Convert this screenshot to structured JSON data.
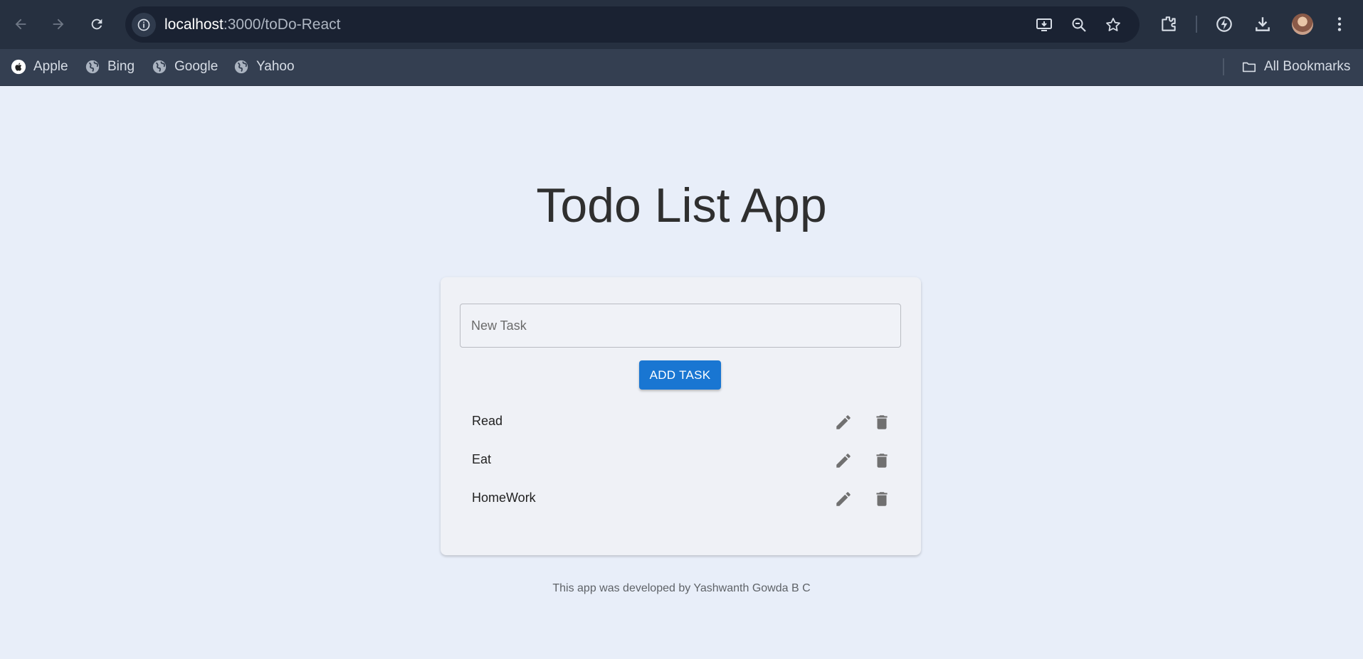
{
  "browser": {
    "url_host": "localhost",
    "url_path": ":3000/toDo-React",
    "bookmarks": [
      {
        "label": "Apple",
        "icon": "apple-icon"
      },
      {
        "label": "Bing",
        "icon": "globe-icon"
      },
      {
        "label": "Google",
        "icon": "globe-icon"
      },
      {
        "label": "Yahoo",
        "icon": "globe-icon"
      }
    ],
    "all_bookmarks_label": "All Bookmarks"
  },
  "app": {
    "title": "Todo List App",
    "input_placeholder": "New Task",
    "input_value": "",
    "add_button_label": "ADD TASK",
    "tasks": [
      {
        "text": "Read"
      },
      {
        "text": "Eat"
      },
      {
        "text": "HomeWork"
      }
    ],
    "footer": "This app was developed by Yashwanth Gowda B C",
    "colors": {
      "primary": "#1976d2",
      "page_background": "#e8eef9",
      "card_background": "#eff1f6",
      "icon_gray": "#707070"
    }
  }
}
